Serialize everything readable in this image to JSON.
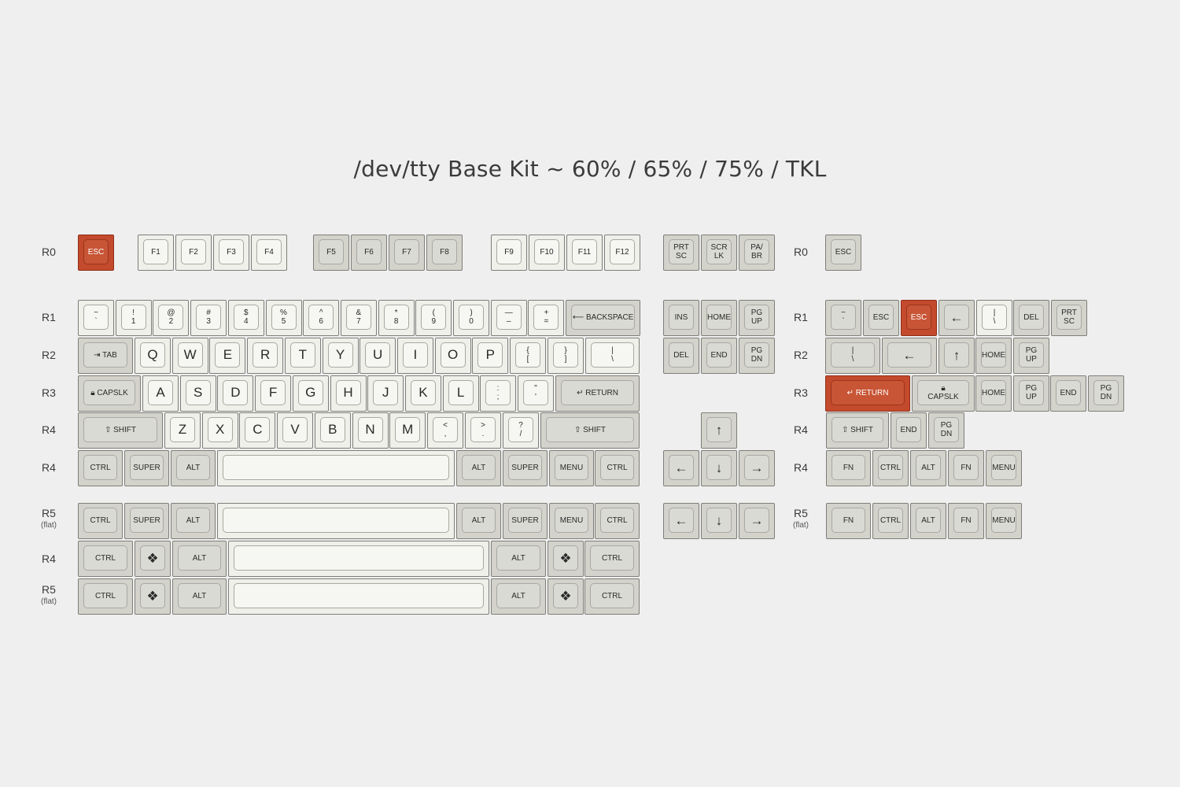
{
  "title": "/dev/tty Base Kit ~ 60% / 65% / 75% / TKL",
  "row_labels": {
    "left": [
      {
        "label": "R0",
        "sub": ""
      },
      {
        "label": "R1",
        "sub": ""
      },
      {
        "label": "R2",
        "sub": ""
      },
      {
        "label": "R3",
        "sub": ""
      },
      {
        "label": "R4",
        "sub": ""
      },
      {
        "label": "R4",
        "sub": ""
      },
      {
        "label": "R5",
        "sub": "(flat)"
      },
      {
        "label": "R4",
        "sub": ""
      },
      {
        "label": "R5",
        "sub": "(flat)"
      }
    ],
    "right": [
      {
        "label": "R0",
        "sub": ""
      },
      {
        "label": "R1",
        "sub": ""
      },
      {
        "label": "R2",
        "sub": ""
      },
      {
        "label": "R3",
        "sub": ""
      },
      {
        "label": "R4",
        "sub": ""
      },
      {
        "label": "R4",
        "sub": ""
      },
      {
        "label": "R5",
        "sub": "(flat)"
      }
    ]
  },
  "colors": {
    "alpha": "#f0f0eb",
    "mod": "#d3d3cc",
    "accent": "#c34a2c",
    "background": "#efefef"
  },
  "keys": {
    "esc": "ESC",
    "f": [
      "F1",
      "F2",
      "F3",
      "F4",
      "F5",
      "F6",
      "F7",
      "F8",
      "F9",
      "F10",
      "F11",
      "F12"
    ],
    "prtsc": "PRT\nSC",
    "scrlk": "SCR\nLK",
    "pabr": "PA/\nBR",
    "num_top": [
      "~",
      "!",
      "@",
      "#",
      "$",
      "%",
      "^",
      "&",
      "*",
      "(",
      ")",
      "—",
      "+"
    ],
    "num_bottom": [
      "`",
      "1",
      "2",
      "3",
      "4",
      "5",
      "6",
      "7",
      "8",
      "9",
      "0",
      "–",
      "="
    ],
    "backspace": "BACKSPACE",
    "tab": "TAB",
    "qrow": [
      "Q",
      "W",
      "E",
      "R",
      "T",
      "Y",
      "U",
      "I",
      "O",
      "P"
    ],
    "brackets_top": [
      "{",
      "}",
      "|"
    ],
    "brackets_bottom": [
      "[",
      "]",
      "\\"
    ],
    "capslk": "CAPSLK",
    "arow": [
      "A",
      "S",
      "D",
      "F",
      "G",
      "H",
      "J",
      "K",
      "L"
    ],
    "semi_top": [
      ":",
      "\""
    ],
    "semi_bottom": [
      ";",
      "'"
    ],
    "return": "RETURN",
    "shift": "SHIFT",
    "zrow": [
      "Z",
      "X",
      "C",
      "V",
      "B",
      "N",
      "M"
    ],
    "punct_top": [
      "<",
      ">",
      "?"
    ],
    "punct_bottom": [
      ",",
      ".",
      "/"
    ],
    "ctrl": "CTRL",
    "super": "SUPER",
    "alt": "ALT",
    "menu": "MENU",
    "fn": "FN",
    "ins": "INS",
    "home": "HOME",
    "pgup": "PG\nUP",
    "del": "DEL",
    "end": "END",
    "pgdn": "PG\nDN",
    "arrow_left": "←",
    "arrow_right": "→",
    "arrow_up": "↑",
    "arrow_down": "↓",
    "pipe_top": "|",
    "pipe_bottom": "\\",
    "diamond": "❖"
  }
}
